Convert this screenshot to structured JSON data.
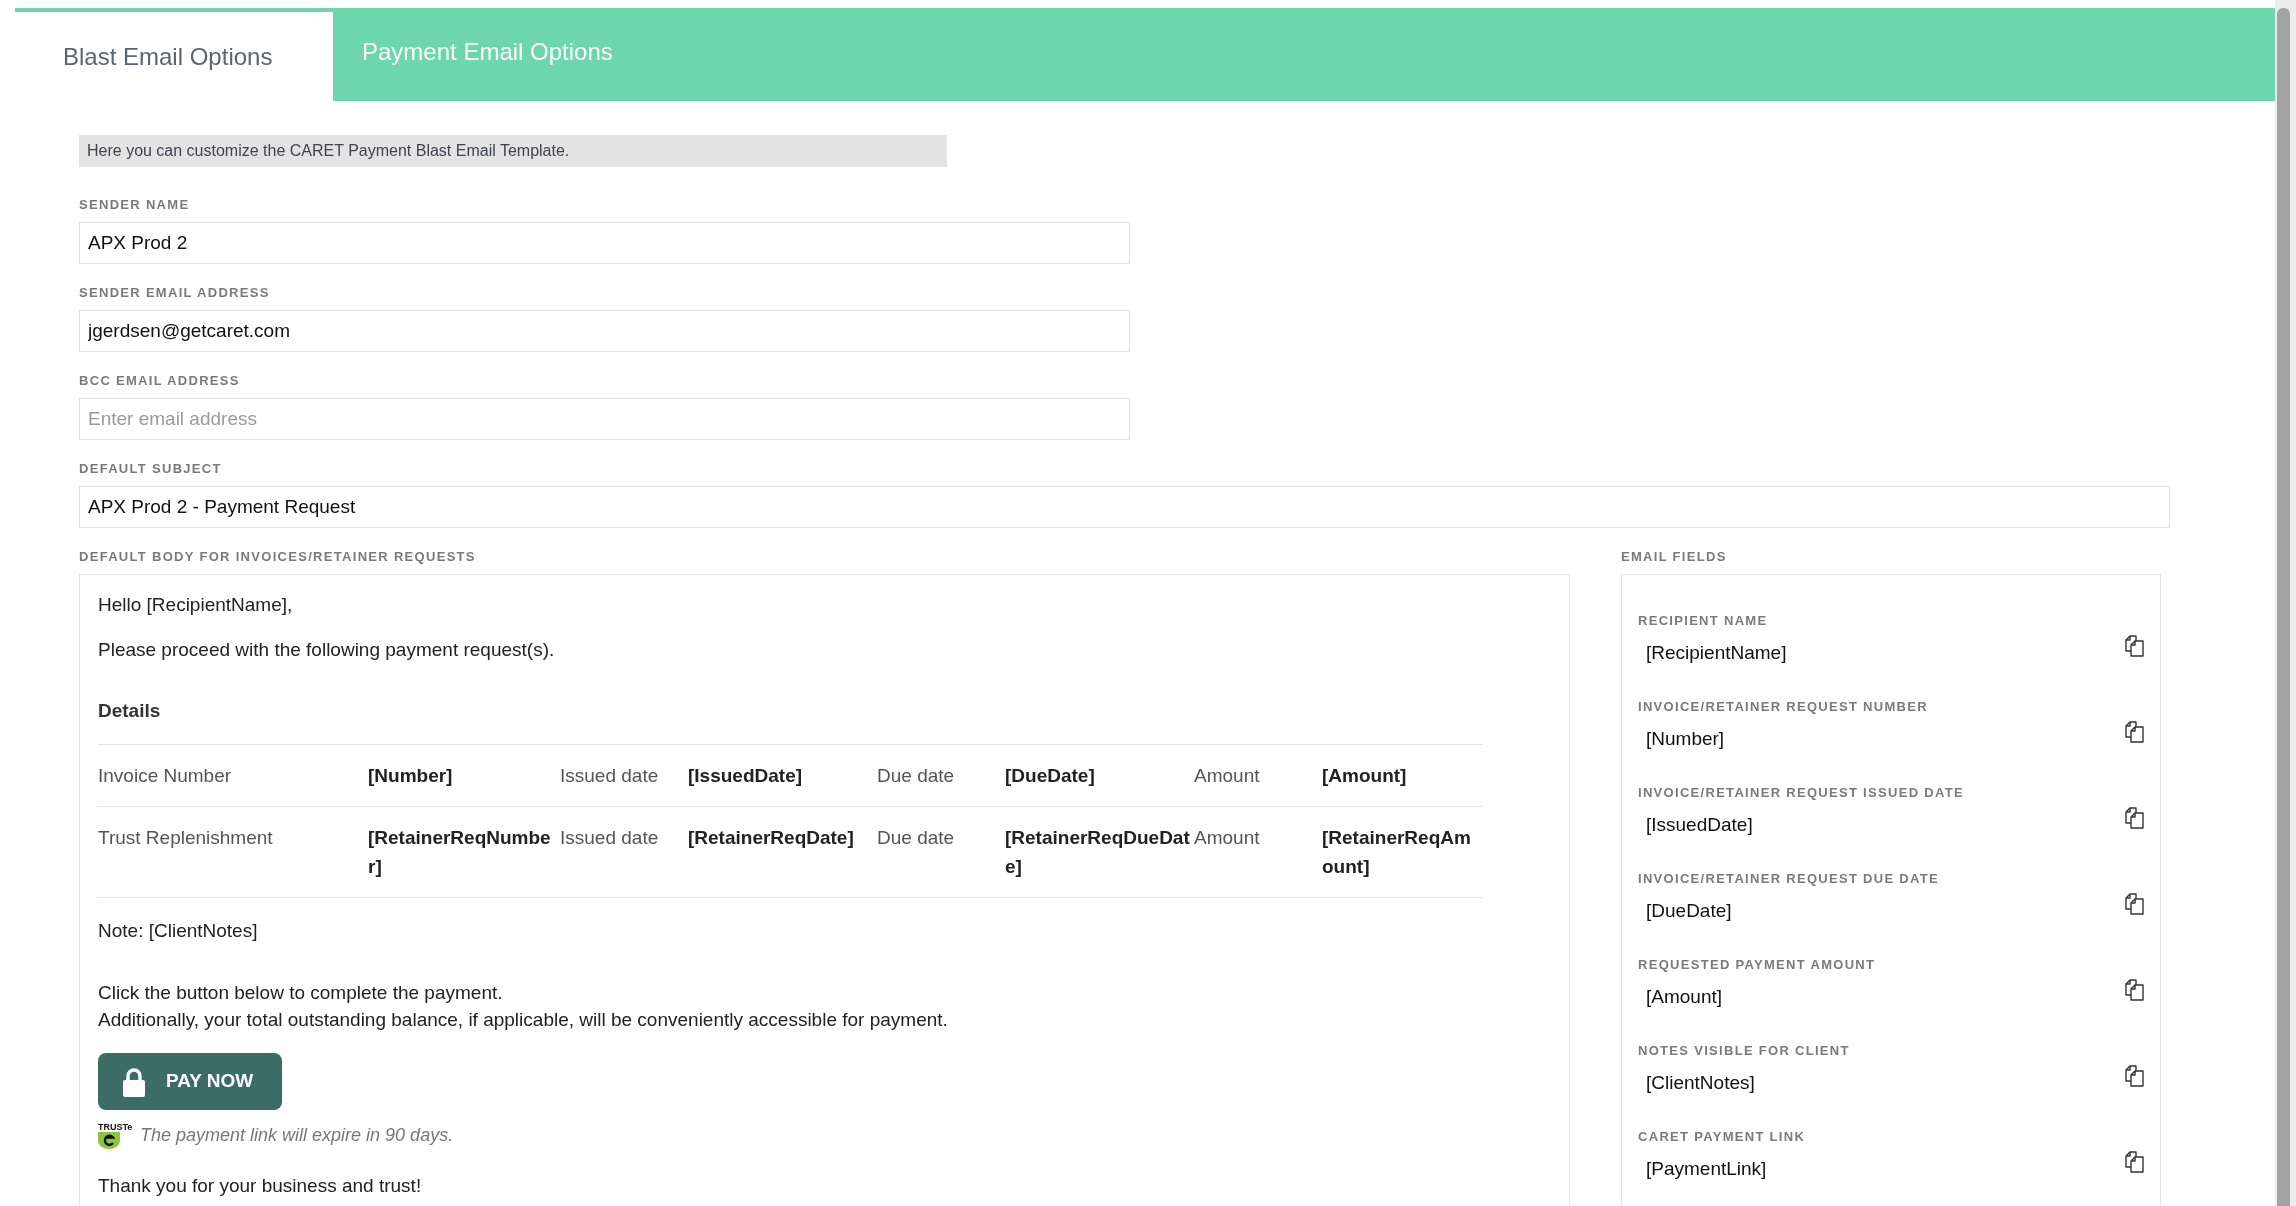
{
  "tabs": [
    {
      "label": "Blast Email Options",
      "selected": true
    },
    {
      "label": "Payment Email Options",
      "selected": false
    }
  ],
  "info_banner": "Here you can customize the CARET Payment Blast Email Template.",
  "fields": [
    {
      "label": "SENDER NAME",
      "value": "APX Prod 2"
    },
    {
      "label": "SENDER EMAIL ADDRESS",
      "value": "jgerdsen@getcaret.com"
    },
    {
      "label": "BCC EMAIL ADDRESS",
      "placeholder": "Enter email address"
    },
    {
      "label": "DEFAULT SUBJECT",
      "value": "APX Prod 2 - Payment Request"
    }
  ],
  "body": {
    "label": "DEFAULT BODY FOR INVOICES/RETAINER REQUESTS",
    "greeting": "Hello [RecipientName],",
    "intro": "Please proceed with the following payment request(s).",
    "details_heading": "Details",
    "details_rows": [
      [
        "Invoice Number",
        "[Number]",
        "Issued date",
        "[IssuedDate]",
        "Due date",
        "[DueDate]",
        "Amount",
        "[Amount]"
      ],
      [
        "Trust Replenishment",
        "[RetainerReqNumber]",
        "Issued date",
        "[RetainerReqDate]",
        "Due date",
        "[RetainerReqDueDate]",
        "Amount",
        "[RetainerReqAmount]"
      ]
    ],
    "note": "Note: [ClientNotes]",
    "instructions": [
      "Click the button below to complete the payment.",
      "Additionally, your total outstanding balance, if applicable, will be conveniently accessible for payment."
    ],
    "pay_button": {
      "label": "PAY NOW"
    },
    "trust_badge": {
      "label": "TRUSTe"
    },
    "expiry_note": "The payment link will expire in 90 days.",
    "closing": "Thank you for your business and trust!"
  },
  "email_fields": {
    "title": "EMAIL FIELDS",
    "items": [
      {
        "label": "RECIPIENT NAME",
        "value": "[RecipientName]"
      },
      {
        "label": "INVOICE/RETAINER REQUEST NUMBER",
        "value": "[Number]"
      },
      {
        "label": "INVOICE/RETAINER REQUEST ISSUED DATE",
        "value": "[IssuedDate]"
      },
      {
        "label": "INVOICE/RETAINER REQUEST DUE DATE",
        "value": "[DueDate]"
      },
      {
        "label": "REQUESTED PAYMENT AMOUNT",
        "value": "[Amount]"
      },
      {
        "label": "NOTES VISIBLE FOR CLIENT",
        "value": "[ClientNotes]"
      },
      {
        "label": "CARET PAYMENT LINK",
        "value": "[PaymentLink]"
      }
    ]
  }
}
